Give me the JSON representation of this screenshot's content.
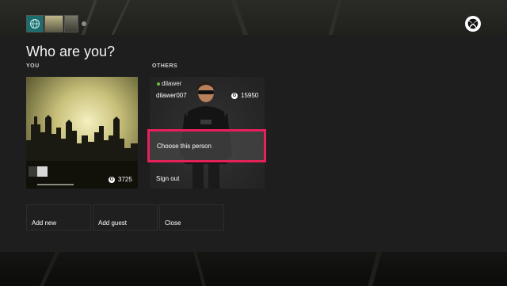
{
  "dialog": {
    "title": "Who are you?",
    "you_label": "YOU",
    "others_label": "OTHERS"
  },
  "you": {
    "gamerscore": "3725"
  },
  "other_profile": {
    "name": "dilawer",
    "gamertag": "dilawer007",
    "gamerscore": "15950",
    "status": "online"
  },
  "actions": {
    "choose": "Choose this person",
    "sign_out": "Sign out",
    "add_new": "Add new",
    "add_guest": "Add guest",
    "close": "Close"
  },
  "icons": {
    "gamerscore": "G",
    "brand": "xbox-logo-icon",
    "home_tile": "globe-icon"
  },
  "colors": {
    "highlight": "#e8205a",
    "online": "#6fc33b",
    "panel": "#1e1e1e"
  }
}
